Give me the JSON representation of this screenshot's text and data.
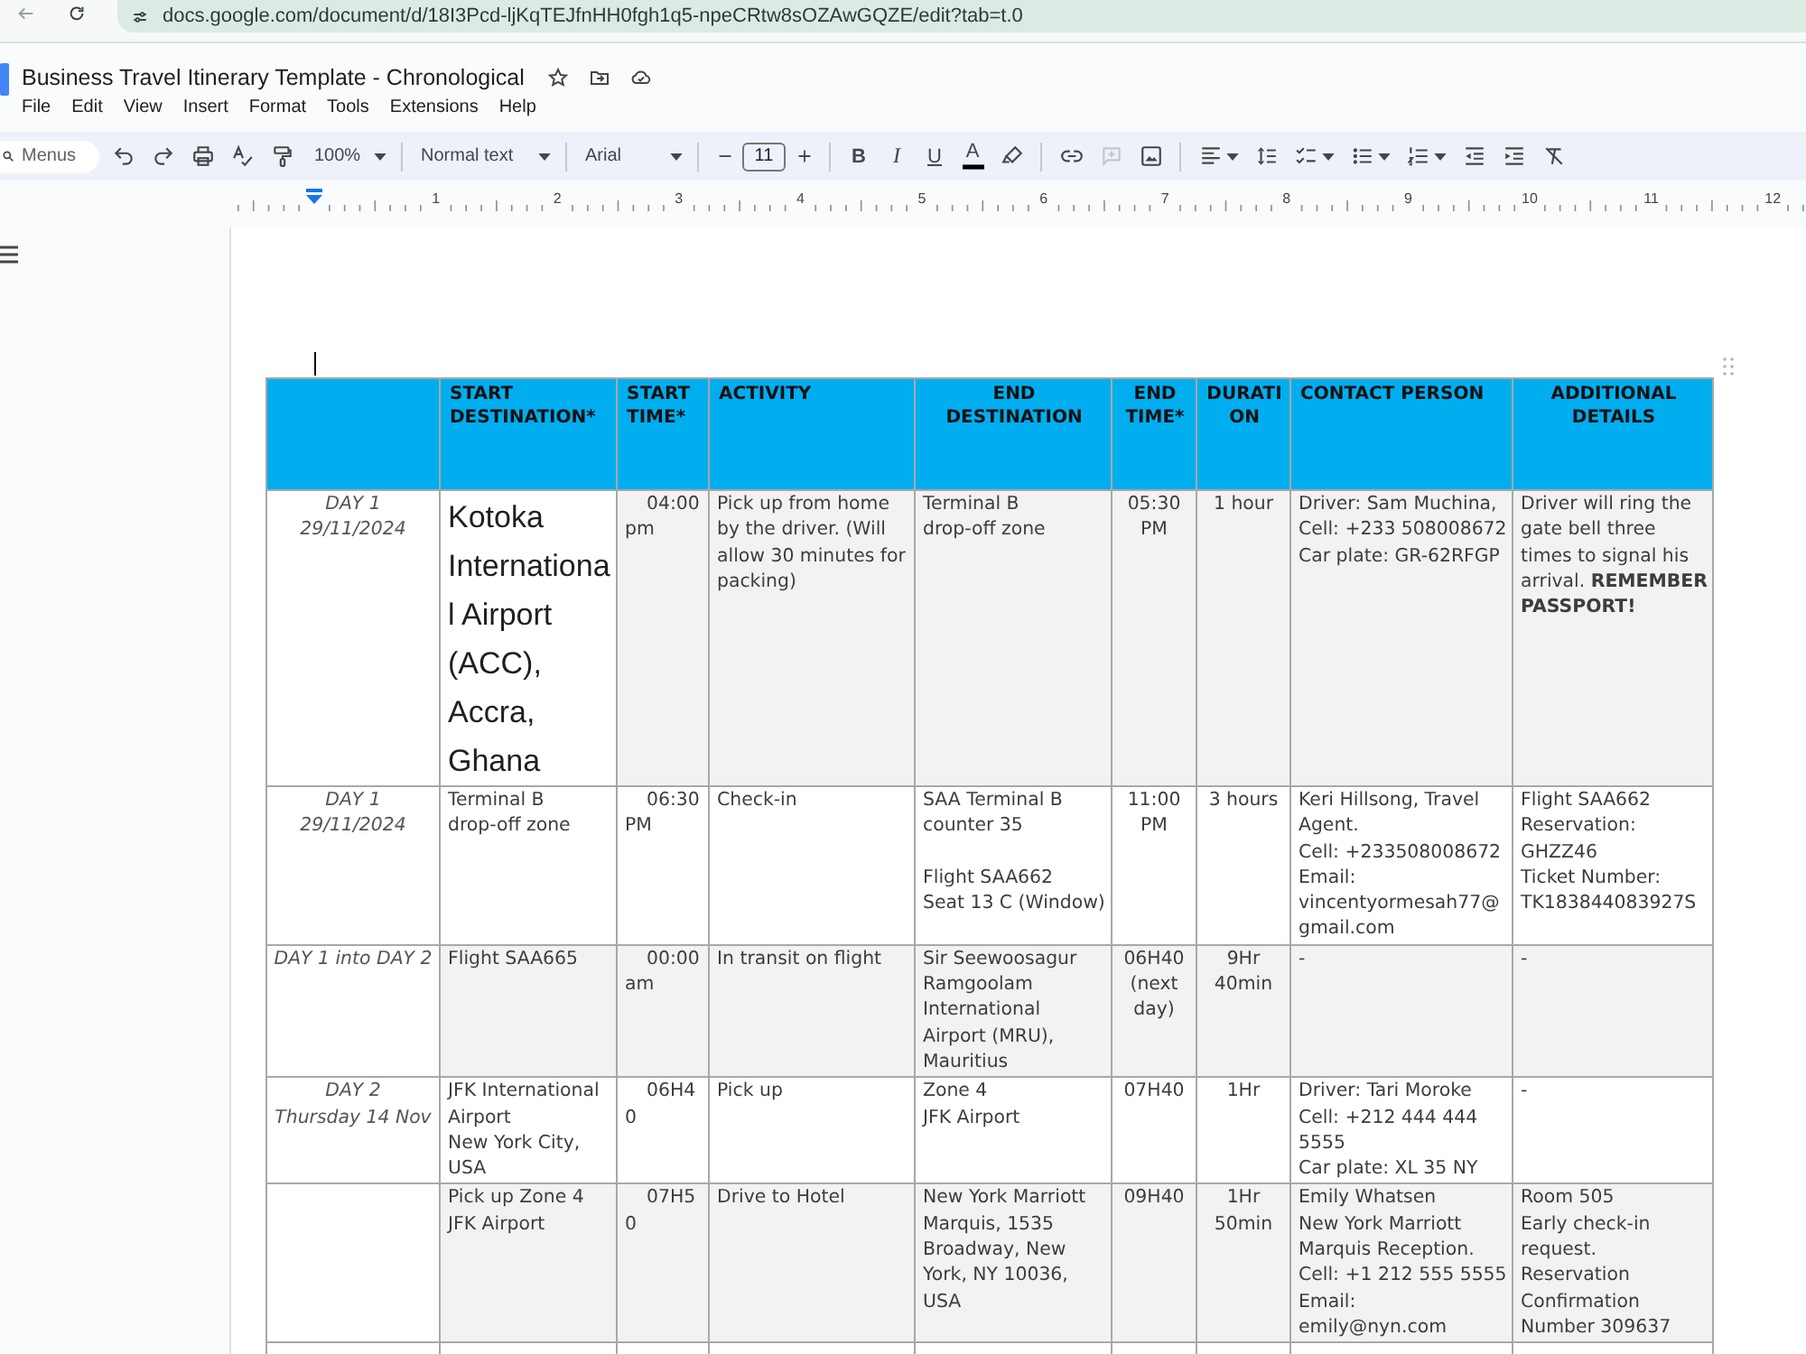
{
  "browser": {
    "url": "docs.google.com/document/d/18I3Pcd-ljKqTEJfnHH0fgh1q5-npeCRtw8sOZAwGQZE/edit?tab=t.0"
  },
  "document": {
    "title": "Business Travel Itinerary Template - Chronological",
    "starred": false
  },
  "menu": [
    "File",
    "Edit",
    "View",
    "Insert",
    "Format",
    "Tools",
    "Extensions",
    "Help"
  ],
  "toolbar": {
    "search": {
      "placeholder": "Menus"
    },
    "zoom": "100%",
    "style": "Normal text",
    "font": "Arial",
    "font_size": "11",
    "bold": "B",
    "italic": "I",
    "underline": "U",
    "text_color": "A",
    "add_comment": {
      "disabled": true
    }
  },
  "ruler": {
    "marks": [
      "1",
      "2",
      "3",
      "4",
      "5",
      "6",
      "7",
      "8",
      "9",
      "10",
      "11",
      "12"
    ]
  },
  "table": {
    "columns": [
      "",
      "START DESTINATION*",
      "START TIME*",
      "ACTIVITY",
      "END DESTINATION",
      "END TIME*",
      "DURATION",
      "CONTACT PERSON",
      "ADDITIONAL DETAILS"
    ],
    "rows": [
      {
        "cells": [
          {
            "text": "DAY 1\n29/11/2024",
            "shaded": false
          },
          {
            "text": "Kotoka International Airport (ACC), Accra, Ghana",
            "shaded": false,
            "large": true
          },
          {
            "text": "04:00 pm",
            "shaded": true
          },
          {
            "text": "Pick up from home by the driver. (Will allow 30 minutes for packing)",
            "shaded": true
          },
          {
            "text": "Terminal B\ndrop-off zone",
            "shaded": true
          },
          {
            "text": "05:30 PM",
            "shaded": true
          },
          {
            "text": "1 hour",
            "shaded": true
          },
          {
            "text": "Driver: Sam Muchina,\nCell: +233 508008672\nCar plate: GR-62RFGP",
            "shaded": true
          },
          {
            "text": "Driver will ring the gate bell three times to signal his arrival. **REMEMBER PASSPORT!**",
            "shaded": true
          }
        ]
      },
      {
        "cells": [
          {
            "text": "DAY 1\n29/11/2024",
            "shaded": false
          },
          {
            "text": "Terminal B\ndrop-off zone",
            "shaded": false
          },
          {
            "text": "06:30 PM",
            "shaded": false
          },
          {
            "text": "Check-in",
            "shaded": false
          },
          {
            "text": "SAA Terminal B\ncounter 35\n\nFlight SAA662\nSeat 13 C (Window)",
            "shaded": false
          },
          {
            "text": "11:00 PM",
            "shaded": false
          },
          {
            "text": "3 hours",
            "shaded": false
          },
          {
            "text": "Keri Hillsong, Travel Agent.\nCell: +233508008672\nEmail:\nvincentyormesah77@gmail.com",
            "shaded": false
          },
          {
            "text": "Flight SAA662\nReservation: GHZZ46\nTicket Number: TK183844083927S",
            "shaded": false
          }
        ]
      },
      {
        "cells": [
          {
            "text": "DAY 1 into DAY 2",
            "shaded": false
          },
          {
            "text": "Flight SAA665",
            "shaded": true
          },
          {
            "text": "00:00 am",
            "shaded": true
          },
          {
            "text": "In transit on flight",
            "shaded": true
          },
          {
            "text": "Sir Seewoosagur Ramgoolam International Airport (MRU), Mauritius",
            "shaded": true
          },
          {
            "text": "06H40 (next day)",
            "shaded": true
          },
          {
            "text": "9Hr 40min",
            "shaded": true
          },
          {
            "text": "-",
            "shaded": true
          },
          {
            "text": "-",
            "shaded": true
          }
        ]
      },
      {
        "cells": [
          {
            "text": "DAY 2\nThursday 14 Nov",
            "shaded": false
          },
          {
            "text": "JFK International Airport\nNew York City, USA",
            "shaded": false
          },
          {
            "text": "06H40",
            "shaded": false
          },
          {
            "text": "Pick up",
            "shaded": false
          },
          {
            "text": "Zone 4\nJFK Airport",
            "shaded": false
          },
          {
            "text": "07H40",
            "shaded": false
          },
          {
            "text": "1Hr",
            "shaded": false
          },
          {
            "text": "Driver: Tari Moroke\nCell: +212 444 444 5555\nCar plate: XL 35 NY",
            "shaded": false
          },
          {
            "text": "-",
            "shaded": false
          }
        ]
      },
      {
        "cells": [
          {
            "shaded": false
          },
          {
            "text": "Pick up Zone 4\nJFK Airport",
            "shaded": true
          },
          {
            "text": "07H50",
            "shaded": true
          },
          {
            "text": "Drive to Hotel",
            "shaded": true
          },
          {
            "text": "New York Marriott Marquis, 1535 Broadway, New York, NY 10036, USA",
            "shaded": true
          },
          {
            "text": "09H40",
            "shaded": true
          },
          {
            "text": "1Hr 50min",
            "shaded": true
          },
          {
            "text": "Emily Whatsen\nNew York Marriott Marquis Reception.\nCell: +1 212 555 5555\nEmail:\nemily@nyn.com",
            "shaded": true
          },
          {
            "text": "Room 505\nEarly check-in request.\nReservation Confirmation Number 309637",
            "shaded": true
          }
        ]
      }
    ]
  }
}
